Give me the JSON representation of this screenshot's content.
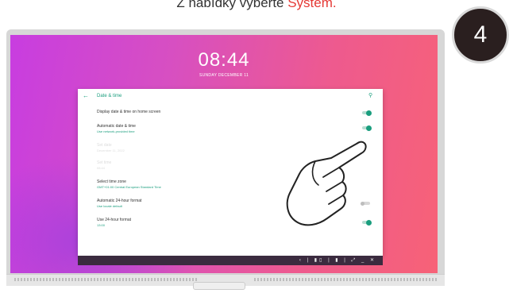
{
  "caption": {
    "prefix": "Z nabídky vyberte ",
    "highlight": "Systém."
  },
  "step": "4",
  "lockscreen": {
    "time": "08:44",
    "date": "SUNDAY DECEMBER 11"
  },
  "window": {
    "title": "Date & time",
    "settings": [
      {
        "title": "Display date & time on home screen",
        "subtitle": "",
        "toggle": "on"
      },
      {
        "title": "Automatic date & time",
        "subtitle": "Use network-provided time",
        "toggle": "on"
      },
      {
        "title": "Set date",
        "subtitle": "December 11, 2022",
        "toggle": "none",
        "disabled": true
      },
      {
        "title": "Set time",
        "subtitle": "08:44",
        "toggle": "none",
        "disabled": true
      },
      {
        "title": "Select time zone",
        "subtitle": "GMT+01:00 Central European Standard Time",
        "toggle": "none"
      },
      {
        "title": "Automatic 24-hour format",
        "subtitle": "Use locale default",
        "toggle": "off"
      },
      {
        "title": "Use 24-hour format",
        "subtitle": "13:00",
        "toggle": "on"
      }
    ]
  },
  "taskbar": {
    "icons": "‹ | ▮▯ | ▮ | ⤢ _ ✕"
  },
  "icons": {
    "back": "back-arrow-icon",
    "search": "search-icon",
    "hand": "pointing-hand-icon"
  },
  "colors": {
    "accent": "#1a9e7e",
    "highlight": "#e53935",
    "badge": "#2a1f1f"
  }
}
